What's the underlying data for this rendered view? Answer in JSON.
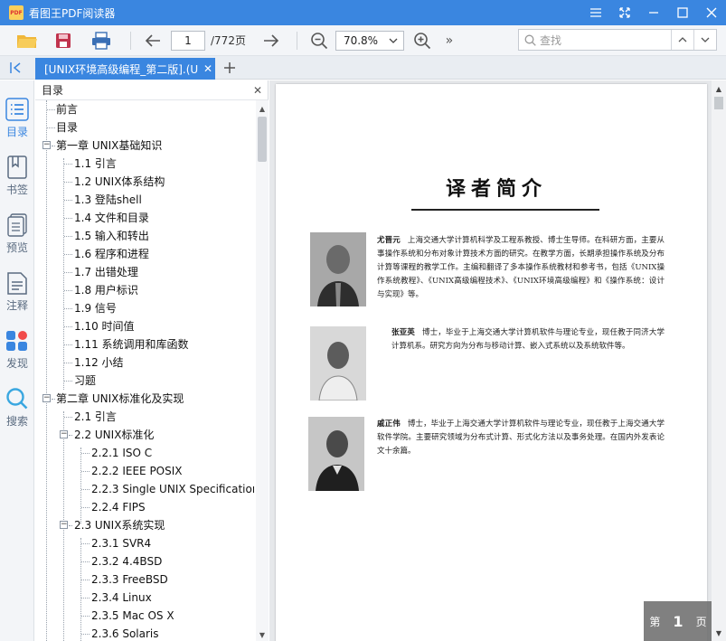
{
  "app": {
    "title": "看图王PDF阅读器",
    "logo_text": "PDF"
  },
  "toolbar": {
    "page_current": "1",
    "page_total": "/772页",
    "zoom": "70.8%",
    "more": "»",
    "search_placeholder": "查找"
  },
  "tabs": [
    {
      "label": "[UNIX环境高级编程_第二版].(U"
    }
  ],
  "rail": [
    {
      "label": "目录",
      "icon": "list-icon"
    },
    {
      "label": "书签",
      "icon": "bookmark-icon"
    },
    {
      "label": "预览",
      "icon": "preview-icon"
    },
    {
      "label": "注释",
      "icon": "annotation-icon"
    },
    {
      "label": "发现",
      "icon": "discover-icon"
    },
    {
      "label": "搜索",
      "icon": "search-icon"
    }
  ],
  "outline": {
    "title": "目录",
    "items": [
      {
        "label": "前言"
      },
      {
        "label": "目录"
      },
      {
        "label": "第一章 UNIX基础知识"
      },
      {
        "label": "1.1 引言"
      },
      {
        "label": "1.2 UNIX体系结构"
      },
      {
        "label": "1.3 登陆shell"
      },
      {
        "label": "1.4 文件和目录"
      },
      {
        "label": "1.5 输入和转出"
      },
      {
        "label": "1.6 程序和进程"
      },
      {
        "label": "1.7 出错处理"
      },
      {
        "label": "1.8 用户标识"
      },
      {
        "label": "1.9 信号"
      },
      {
        "label": "1.10 时间值"
      },
      {
        "label": "1.11 系统调用和库函数"
      },
      {
        "label": "1.12 小结"
      },
      {
        "label": "习题"
      },
      {
        "label": "第二章 UNIX标准化及实现"
      },
      {
        "label": "2.1 引言"
      },
      {
        "label": "2.2 UNIX标准化"
      },
      {
        "label": "2.2.1 ISO C"
      },
      {
        "label": "2.2.2 IEEE POSIX"
      },
      {
        "label": "2.2.3 Single UNIX Specification"
      },
      {
        "label": "2.2.4 FIPS"
      },
      {
        "label": "2.3 UNIX系统实现"
      },
      {
        "label": "2.3.1 SVR4"
      },
      {
        "label": "2.3.2 4.4BSD"
      },
      {
        "label": "2.3.3 FreeBSD"
      },
      {
        "label": "2.3.4 Linux"
      },
      {
        "label": "2.3.5 Mac OS X"
      },
      {
        "label": "2.3.6 Solaris"
      }
    ]
  },
  "document": {
    "heading": "译者简介",
    "translators": [
      {
        "name": "尤晋元",
        "text": "上海交通大学计算机科学及工程系教授、博士生导师。在科研方面，主要从事操作系统和分布对象计算技术方面的研究。在教学方面，长期承担操作系统及分布计算等课程的教学工作。主编和翻译了多本操作系统教材和参考书，包括《UNIX操作系统教程》、《UNIX高级编程技术》、《UNIX环境高级编程》和《操作系统：设计与实现》等。"
      },
      {
        "name": "张亚英",
        "text": "博士，毕业于上海交通大学计算机软件与理论专业，现任教于同济大学计算机系。研究方向为分布与移动计算、嵌入式系统以及系统软件等。"
      },
      {
        "name": "戚正伟",
        "text": "博士，毕业于上海交通大学计算机软件与理论专业，现任教于上海交通大学软件学院。主要研究领域为分布式计算、形式化方法以及事务处理。在国内外发表论文十余篇。"
      }
    ]
  },
  "page_badge": {
    "prefix": "第",
    "number": "1",
    "suffix": "页"
  }
}
